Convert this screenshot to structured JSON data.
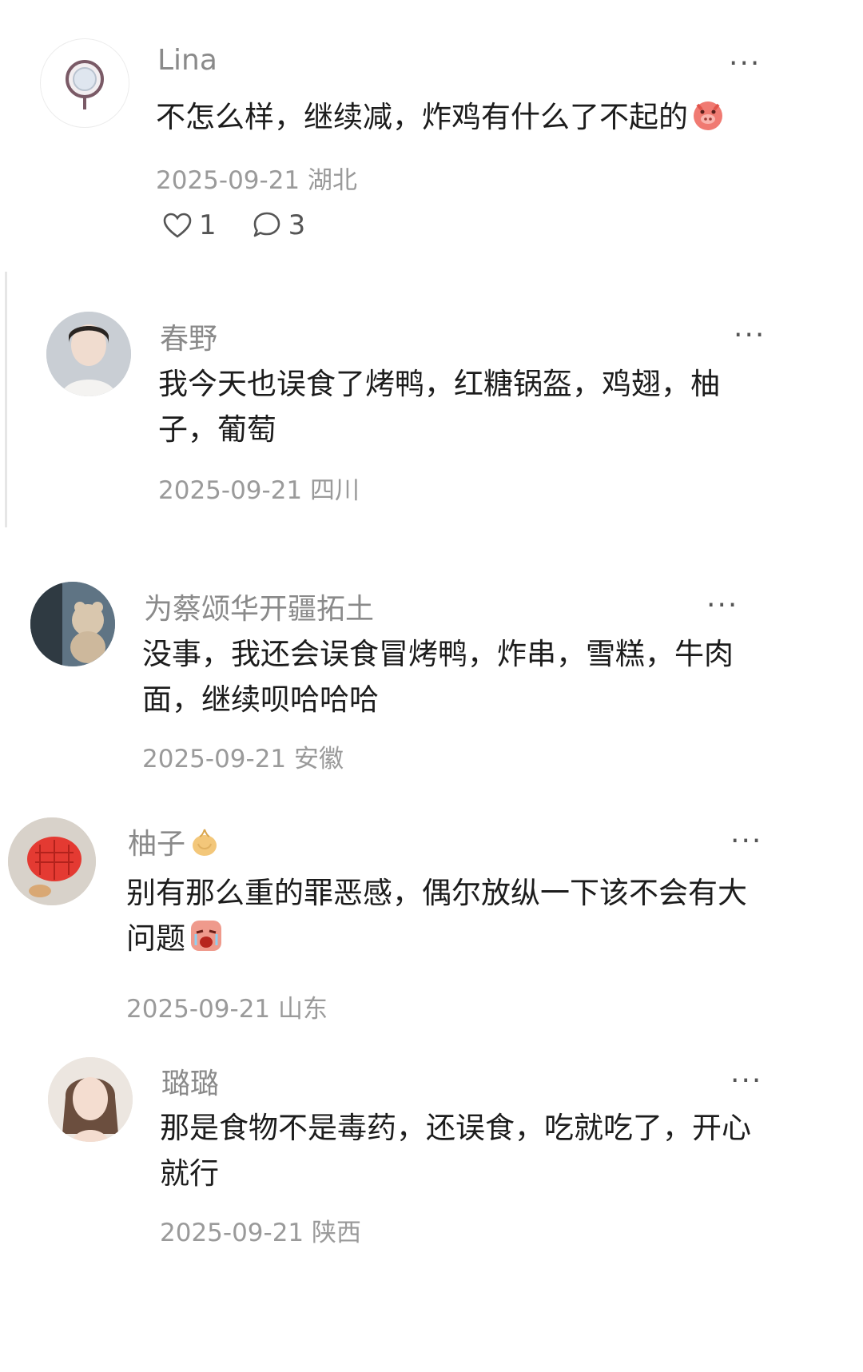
{
  "comments": [
    {
      "username": "Lina",
      "text": "不怎么样，继续减，炸鸡有什么了不起的",
      "date": "2025-09-21",
      "location": "湖北",
      "likes": "1",
      "replies": "3",
      "emoji": "pig-face-emoji"
    },
    {
      "username": "春野",
      "text": "我今天也误食了烤鸭，红糖锅盔，鸡翅，柚子，葡萄",
      "date": "2025-09-21",
      "location": "四川"
    },
    {
      "username": "为蔡颂华开疆拓土",
      "text": "没事，我还会误食冒烤鸭，炸串，雪糕，牛肉面，继续呗哈哈哈",
      "date": "2025-09-21",
      "location": "安徽"
    },
    {
      "username": "柚子",
      "username_emoji": "onion-emoji",
      "text": "别有那么重的罪恶感，偶尔放纵一下该不会有大问题",
      "date": "2025-09-21",
      "location": "山东",
      "emoji": "crying-face-emoji"
    },
    {
      "username": "璐璐",
      "text": "那是食物不是毒药，还误食，吃就吃了，开心就行",
      "date": "2025-09-21",
      "location": "陕西"
    }
  ],
  "more_label": "···",
  "colors": {
    "username": "#8a8a8a",
    "meta": "#9a9a9a",
    "text": "#1c1c1c"
  }
}
